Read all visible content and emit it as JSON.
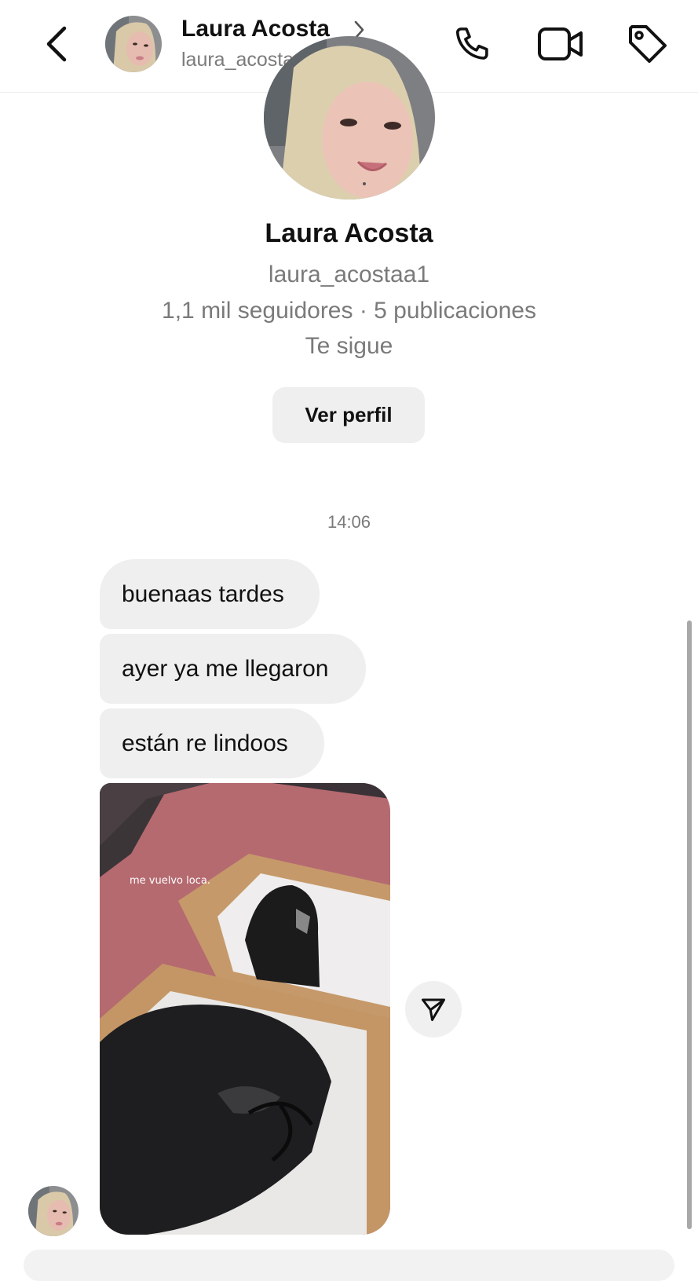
{
  "header": {
    "name": "Laura Acosta",
    "username": "laura_acostaa1",
    "icons": [
      "chevron-left-icon",
      "chevron-right-icon",
      "phone-icon",
      "video-camera-icon",
      "tag-icon"
    ]
  },
  "profile": {
    "name": "Laura Acosta",
    "username": "laura_acostaa1",
    "stats": "1,1 mil seguidores · 5 publicaciones",
    "follow_status": "Te sigue",
    "view_profile_label": "Ver perfil"
  },
  "conversation": {
    "timestamp": "14:06",
    "messages": [
      {
        "text": "buenaas tardes"
      },
      {
        "text": "ayer ya me llegaron"
      },
      {
        "text": "están re lindoos"
      }
    ],
    "photo": {
      "overlay_text": "me vuelvo loca.",
      "description_icon": "photo-message"
    }
  },
  "colors": {
    "background": "#ffffff",
    "bubble": "#efefef",
    "secondary_text": "#7a7a7a",
    "primary_text": "#111111"
  }
}
